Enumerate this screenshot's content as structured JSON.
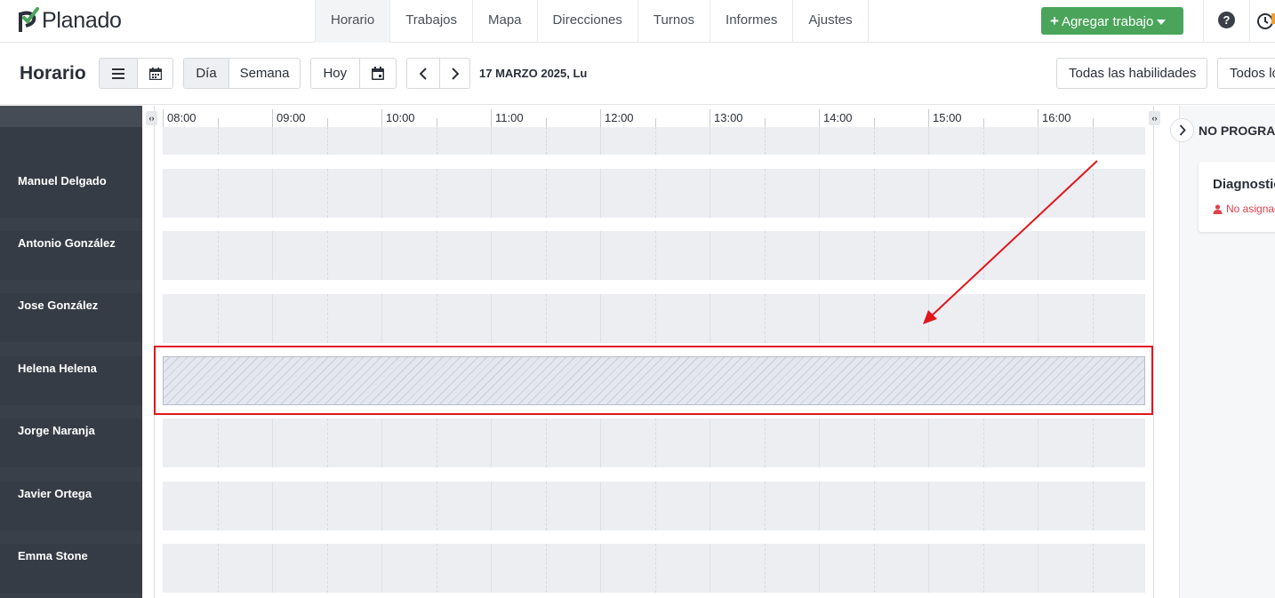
{
  "app": {
    "name": "Planado"
  },
  "nav": {
    "items": [
      {
        "label": "Horario",
        "active": true
      },
      {
        "label": "Trabajos",
        "active": false
      },
      {
        "label": "Mapa",
        "active": false
      },
      {
        "label": "Direcciones",
        "active": false
      },
      {
        "label": "Turnos",
        "active": false
      },
      {
        "label": "Informes",
        "active": false
      },
      {
        "label": "Ajustes",
        "active": false
      }
    ],
    "add_job_label": "Agregar trabajo",
    "help_label": "?"
  },
  "toolbar": {
    "title": "Horario",
    "view_day": "Día",
    "view_week": "Semana",
    "today": "Hoy",
    "date": "17 MARZO 2025, Lu",
    "skills_filter": "Todas las habilidades",
    "all_filter": "Todos los"
  },
  "timeline": {
    "hours": [
      "08:00",
      "09:00",
      "10:00",
      "11:00",
      "12:00",
      "13:00",
      "14:00",
      "15:00",
      "16:00"
    ]
  },
  "technicians": [
    {
      "name": "Manuel Delgado"
    },
    {
      "name": "Antonio González"
    },
    {
      "name": "Jose González"
    },
    {
      "name": "Helena Helena"
    },
    {
      "name": "Jorge Naranja"
    },
    {
      "name": "Javier Ortega"
    },
    {
      "name": "Emma Stone"
    }
  ],
  "unscheduled": {
    "title": "NO PROGRAMADOS",
    "job_title": "Diagnostico",
    "job_status": "No asignado"
  },
  "colors": {
    "brand_green": "#4aa55a",
    "sidebar_bg": "#3a404a",
    "highlight": "#e0161e",
    "unassigned": "#e0404a"
  }
}
